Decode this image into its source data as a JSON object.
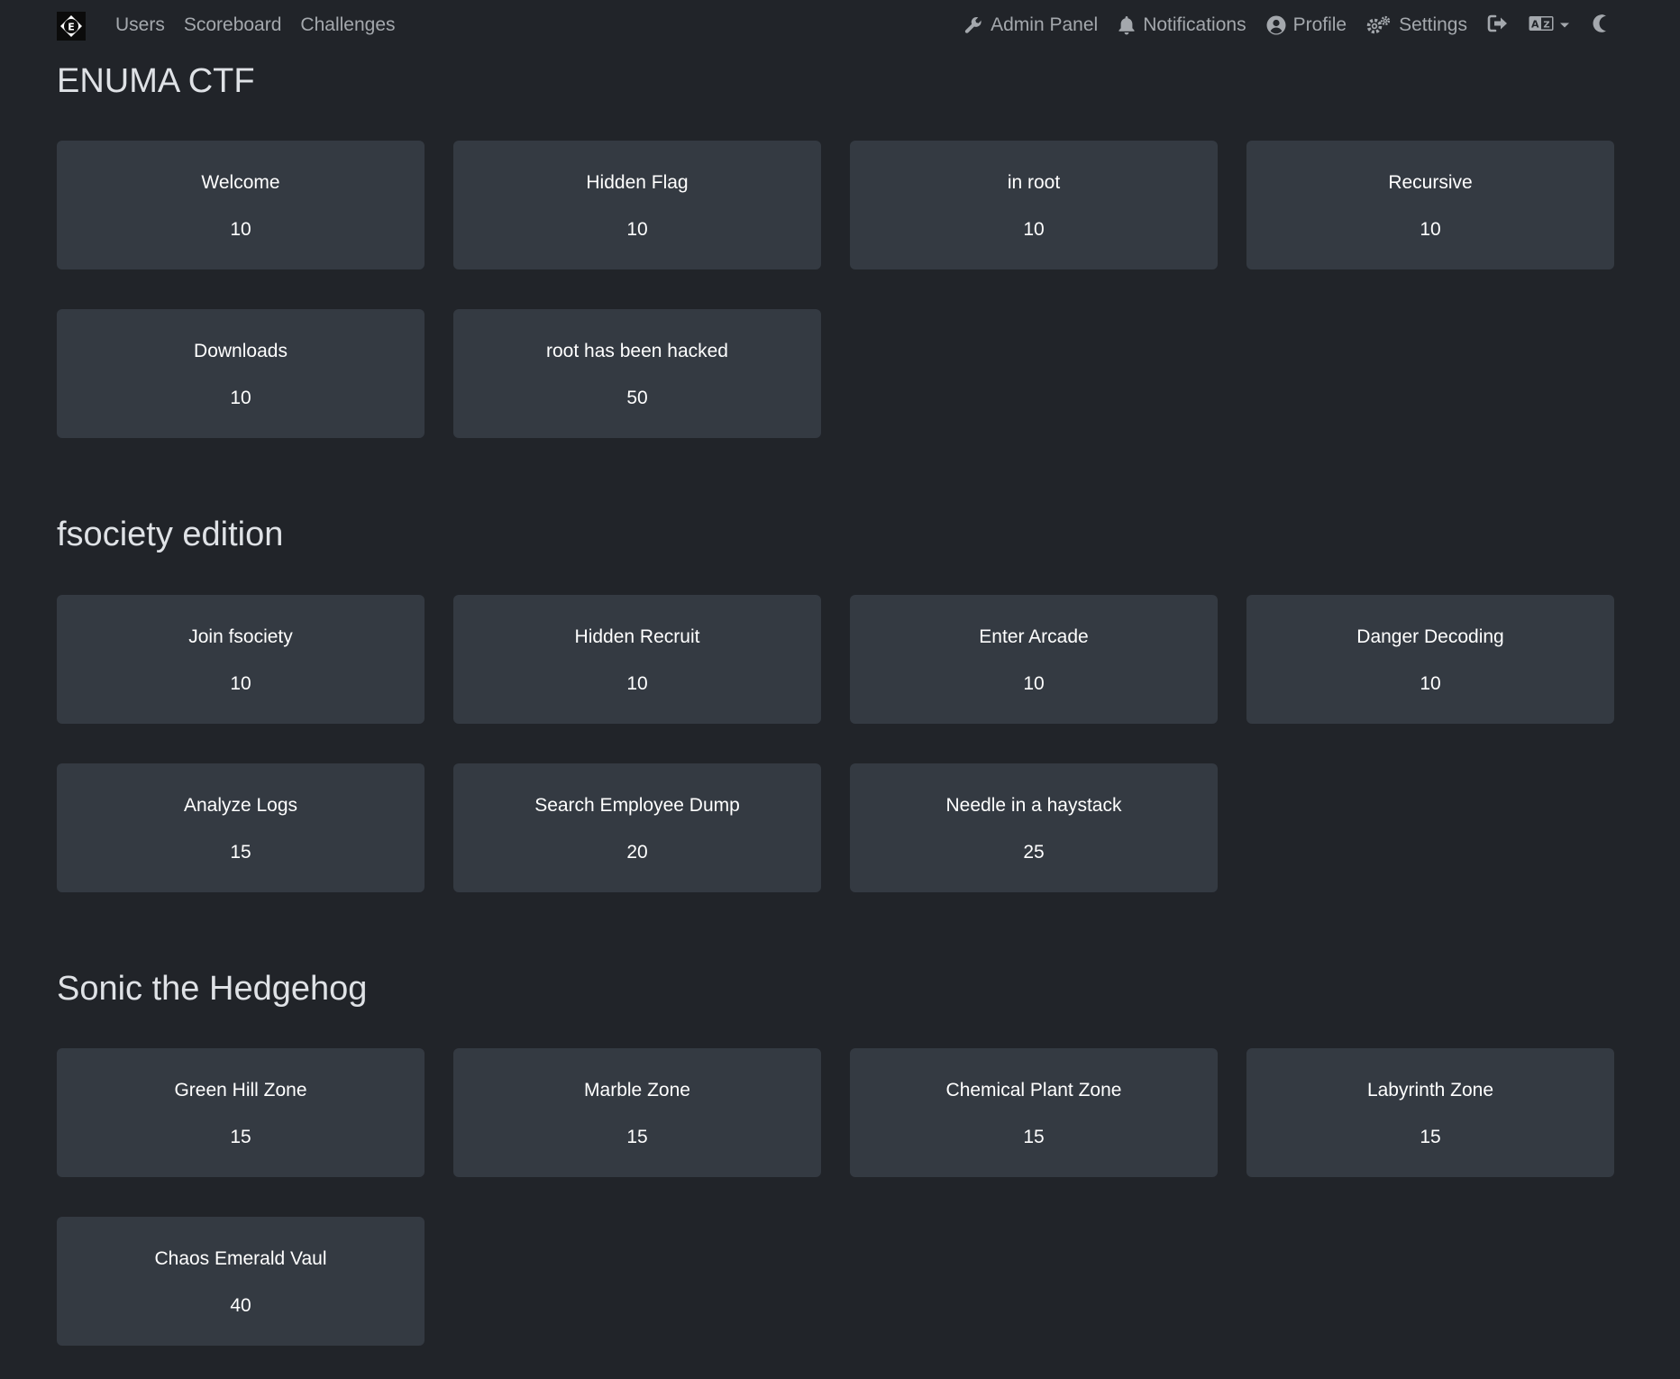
{
  "nav": {
    "brand_icon": "ctf-logo-icon",
    "links": [
      "Users",
      "Scoreboard",
      "Challenges"
    ],
    "right": {
      "admin_panel": "Admin Panel",
      "notifications": "Notifications",
      "profile": "Profile",
      "settings": "Settings"
    }
  },
  "sections": [
    {
      "title": "ENUMA CTF",
      "challenges": [
        {
          "name": "Welcome",
          "value": "10"
        },
        {
          "name": "Hidden Flag",
          "value": "10"
        },
        {
          "name": "in root",
          "value": "10"
        },
        {
          "name": "Recursive",
          "value": "10"
        },
        {
          "name": "Downloads",
          "value": "10"
        },
        {
          "name": "root has been hacked",
          "value": "50"
        }
      ]
    },
    {
      "title": "fsociety edition",
      "challenges": [
        {
          "name": "Join fsociety",
          "value": "10"
        },
        {
          "name": "Hidden Recruit",
          "value": "10"
        },
        {
          "name": "Enter Arcade",
          "value": "10"
        },
        {
          "name": "Danger Decoding",
          "value": "10"
        },
        {
          "name": "Analyze Logs",
          "value": "15"
        },
        {
          "name": "Search Employee Dump",
          "value": "20"
        },
        {
          "name": "Needle in a haystack",
          "value": "25"
        }
      ]
    },
    {
      "title": "Sonic the Hedgehog",
      "challenges": [
        {
          "name": "Green Hill Zone",
          "value": "15"
        },
        {
          "name": "Marble Zone",
          "value": "15"
        },
        {
          "name": "Chemical Plant Zone",
          "value": "15"
        },
        {
          "name": "Labyrinth Zone",
          "value": "15"
        },
        {
          "name": "Chaos Emerald Vaul",
          "value": "40"
        }
      ]
    }
  ],
  "colors": {
    "background": "#212429",
    "card": "#343a42",
    "nav_text": "#a4a8ad",
    "title_text": "#dfe2e6"
  }
}
